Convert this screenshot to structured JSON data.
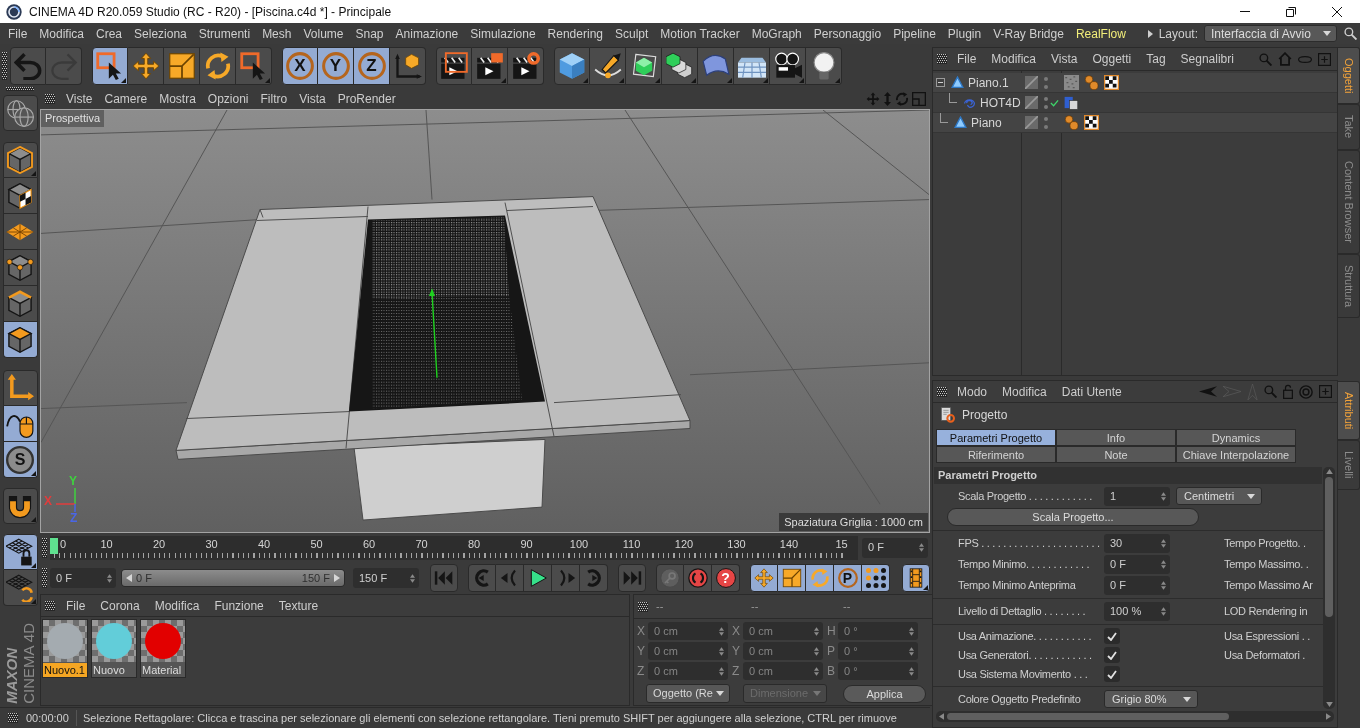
{
  "window": {
    "title": "CINEMA 4D R20.059 Studio (RC - R20) - [Piscina.c4d *] - Principale"
  },
  "menu_bar": {
    "items": [
      {
        "label": "File",
        "highlighted": false
      },
      {
        "label": "Modifica",
        "highlighted": false
      },
      {
        "label": "Crea",
        "highlighted": false
      },
      {
        "label": "Seleziona",
        "highlighted": false
      },
      {
        "label": "Strumenti",
        "highlighted": false
      },
      {
        "label": "Mesh",
        "highlighted": false
      },
      {
        "label": "Volume",
        "highlighted": false
      },
      {
        "label": "Snap",
        "highlighted": false
      },
      {
        "label": "Animazione",
        "highlighted": false
      },
      {
        "label": "Simulazione",
        "highlighted": false
      },
      {
        "label": "Rendering",
        "highlighted": false
      },
      {
        "label": "Sculpt",
        "highlighted": false
      },
      {
        "label": "Motion Tracker",
        "highlighted": false
      },
      {
        "label": "MoGraph",
        "highlighted": false
      },
      {
        "label": "Personaggio",
        "highlighted": false
      },
      {
        "label": "Pipeline",
        "highlighted": false
      },
      {
        "label": "Plugin",
        "highlighted": false
      },
      {
        "label": "V-Ray Bridge",
        "highlighted": false
      },
      {
        "label": "RealFlow",
        "highlighted": true
      }
    ],
    "layout_label": "Layout:",
    "layout": "Interfaccia di Avvio"
  },
  "toolbar": [
    [
      {
        "kind": "undo",
        "disabled": false
      },
      {
        "kind": "redo",
        "disabled": true
      }
    ],
    [
      {
        "kind": "select",
        "selected": true
      },
      {
        "kind": "move",
        "selected": false
      },
      {
        "kind": "scale",
        "selected": false
      },
      {
        "kind": "rotate",
        "selected": false
      },
      {
        "kind": "liveselect",
        "selected": false
      }
    ],
    [
      {
        "kind": "axis",
        "label": "X",
        "selected": true
      },
      {
        "kind": "axis",
        "label": "Y",
        "selected": true
      },
      {
        "kind": "axis",
        "label": "Z",
        "selected": true
      },
      {
        "kind": "coords",
        "selected": false
      }
    ],
    [
      {
        "kind": "renderview",
        "selected": false
      },
      {
        "kind": "renderpv",
        "selected": false
      },
      {
        "kind": "rendersettings",
        "selected": false
      }
    ],
    [
      {
        "kind": "cube",
        "selected": false
      },
      {
        "kind": "pen",
        "selected": false
      },
      {
        "kind": "subdivision",
        "selected": false
      },
      {
        "kind": "cloner",
        "selected": false
      },
      {
        "kind": "bend",
        "selected": false
      },
      {
        "kind": "floor",
        "selected": false
      },
      {
        "kind": "camera",
        "selected": false
      },
      {
        "kind": "light",
        "selected": false
      }
    ]
  ],
  "left_toolbar": [
    [
      {
        "kind": "editable",
        "selected": false
      }
    ],
    [
      {
        "kind": "model",
        "selected": false
      },
      {
        "kind": "texture",
        "selected": false
      },
      {
        "kind": "workplane",
        "selected": false
      },
      {
        "kind": "points",
        "selected": false
      },
      {
        "kind": "edges",
        "selected": false
      },
      {
        "kind": "polygons",
        "selected": true
      }
    ],
    [
      {
        "kind": "axismode",
        "selected": false
      },
      {
        "kind": "tweak",
        "selected": true
      },
      {
        "kind": "soft",
        "label": "S",
        "selected": true
      }
    ],
    [
      {
        "kind": "snap",
        "selected": false
      }
    ],
    [
      {
        "kind": "lock",
        "selected": true
      },
      {
        "kind": "align",
        "selected": false
      }
    ]
  ],
  "logo": {
    "brand": "MAXON",
    "product": "CINEMA 4D"
  },
  "viewport": {
    "menu": [
      "Viste",
      "Camere",
      "Mostra",
      "Opzioni",
      "Filtro",
      "Vista",
      "ProRender"
    ],
    "camera": "Prospettiva",
    "grid_spacing": "Spaziatura Griglia : 1000 cm",
    "axes": [
      {
        "label": "Y",
        "color": "#3fd13f"
      },
      {
        "label": "X",
        "color": "#e23c3c"
      },
      {
        "label": "Z",
        "color": "#4a66e6"
      }
    ]
  },
  "timeline": {
    "ticks": [
      "0",
      "10",
      "20",
      "30",
      "40",
      "50",
      "60",
      "70",
      "80",
      "90",
      "100",
      "110",
      "120",
      "130",
      "140",
      "15"
    ],
    "level": 0,
    "current_frame": "0 F"
  },
  "transport": {
    "start": "0 F",
    "range": {
      "start": "0 F",
      "end": "150 F",
      "level": 1
    },
    "end": "150 F",
    "playback": [
      [
        {
          "kind": "first"
        }
      ],
      [
        {
          "kind": "prevkey"
        },
        {
          "kind": "prevframe"
        },
        {
          "kind": "play"
        },
        {
          "kind": "nextframe"
        },
        {
          "kind": "nextkey"
        }
      ],
      [
        {
          "kind": "last"
        }
      ]
    ],
    "keys": [
      {
        "kind": "key",
        "disabled": true
      },
      {
        "kind": "record",
        "disabled": false
      },
      {
        "kind": "autokey",
        "label": "?",
        "disabled": false
      }
    ],
    "channels": [
      {
        "kind": "position",
        "selected": true
      },
      {
        "kind": "scaling",
        "selected": true
      },
      {
        "kind": "rotation",
        "selected": true
      },
      {
        "kind": "parameter",
        "label": "P",
        "selected": true
      },
      {
        "kind": "pla",
        "selected": true
      }
    ],
    "view": [
      {
        "kind": "timeline",
        "selected": true
      }
    ]
  },
  "materials": {
    "menu": [
      "File",
      "Corona",
      "Modifica",
      "Funzione",
      "Texture"
    ],
    "items": [
      {
        "name": "Nuovo.1",
        "selected": true,
        "color": "#a4abb0"
      },
      {
        "name": "Nuovo",
        "selected": false,
        "color": "#62cdd9"
      },
      {
        "name": "Material",
        "selected": false,
        "color": "#e20000"
      }
    ]
  },
  "coordinates": {
    "columns": [
      {
        "header": "--",
        "fields": [
          {
            "axis": "X",
            "value": "0 cm"
          },
          {
            "axis": "Y",
            "value": "0 cm"
          },
          {
            "axis": "Z",
            "value": "0 cm"
          }
        ]
      },
      {
        "header": "--",
        "fields": [
          {
            "axis": "X",
            "value": "0 cm"
          },
          {
            "axis": "Y",
            "value": "0 cm"
          },
          {
            "axis": "Z",
            "value": "0 cm"
          }
        ]
      },
      {
        "header": "--",
        "fields": [
          {
            "axis": "H",
            "value": "0 °"
          },
          {
            "axis": "P",
            "value": "0 °"
          },
          {
            "axis": "B",
            "value": "0 °"
          }
        ]
      }
    ],
    "modes": [
      {
        "value": "Oggetto (Re",
        "disabled": false
      },
      {
        "value": "Dimensione",
        "disabled": true
      }
    ],
    "apply": "Applica"
  },
  "status_bar": {
    "time": "00:00:00",
    "message": "Selezione Rettagolare: Clicca e trascina per selezionare gli elementi con selezione rettangolare. Tieni premuto SHIFT per aggiungere alla selezione, CTRL per rimuove"
  },
  "objects": {
    "menu": [
      "File",
      "Modifica",
      "Vista",
      "Oggetti",
      "Tag",
      "Segnalibri"
    ],
    "tree": [
      {
        "name": "Piano.1",
        "kind": "polygon",
        "expanded": true,
        "enabled": false,
        "tags": [
          {
            "kind": "texture"
          },
          {
            "kind": "phong"
          },
          {
            "kind": "checker"
          }
        ],
        "children": [
          {
            "name": "HOT4D",
            "kind": "hot4d",
            "enabled": true,
            "tags": [
              {
                "kind": "hot4dtag"
              }
            ]
          }
        ]
      },
      {
        "name": "Piano",
        "kind": "polygon",
        "enabled": false,
        "tags": [
          {
            "kind": "phong"
          },
          {
            "kind": "checker"
          }
        ]
      }
    ],
    "side_tabs": [
      {
        "label": "Oggetti",
        "selected": true
      },
      {
        "label": "Take",
        "selected": false
      },
      {
        "label": "Content Browser",
        "selected": false
      },
      {
        "label": "Struttura",
        "selected": false
      }
    ]
  },
  "attributes": {
    "menu": [
      "Modo",
      "Modifica",
      "Dati Utente"
    ],
    "title": "Progetto",
    "tabs": [
      {
        "label": "Parametri Progetto",
        "selected": true
      },
      {
        "label": "Info",
        "selected": false
      },
      {
        "label": "Dynamics",
        "selected": false
      },
      {
        "label": "Riferimento",
        "selected": false
      },
      {
        "label": "Note",
        "selected": false
      },
      {
        "label": "Chiave Interpolazione",
        "selected": false
      }
    ],
    "section": "Parametri Progetto",
    "groups": [
      [
        {
          "kind": "number",
          "label": "Scala Progetto . . . . . . . . . . . .",
          "value": "1",
          "unit": "Centimetri"
        },
        {
          "kind": "button",
          "label": "Scala Progetto..."
        }
      ],
      [
        {
          "kind": "number",
          "label": "FPS . . . . . . . . . . . . . . . . . . . . . .",
          "value": "30",
          "aside": "Tempo Progetto. ."
        },
        {
          "kind": "number",
          "label": "Tempo Minimo. . . . . . . . . . . .",
          "value": "0 F",
          "aside": "Tempo Massimo. ."
        },
        {
          "kind": "number",
          "label": "Tempo Minimo Anteprima",
          "value": "0 F",
          "aside": "Tempo Massimo Ar"
        }
      ],
      [
        {
          "kind": "number",
          "label": "Livello di Dettaglio . . . . . . . .",
          "value": "100 %",
          "aside": "LOD Rendering in"
        }
      ],
      [
        {
          "kind": "checkbox",
          "label": "Usa Animazione. . . . . . . . . . .",
          "checked": true,
          "aside": "Usa Espressioni . ."
        },
        {
          "kind": "checkbox",
          "label": "Usa Generatori. . . . . . . . . . . .",
          "checked": true,
          "aside": "Usa Deformatori ."
        },
        {
          "kind": "checkbox",
          "label": "Usa Sistema Movimento . . .",
          "checked": true
        }
      ],
      [
        {
          "kind": "dropdown",
          "label": "Colore Oggetto Predefinito",
          "value": "Grigio 80%"
        }
      ]
    ],
    "side_tabs": [
      {
        "label": "Attributi",
        "selected": true
      },
      {
        "label": "Livelli",
        "selected": false
      }
    ]
  }
}
